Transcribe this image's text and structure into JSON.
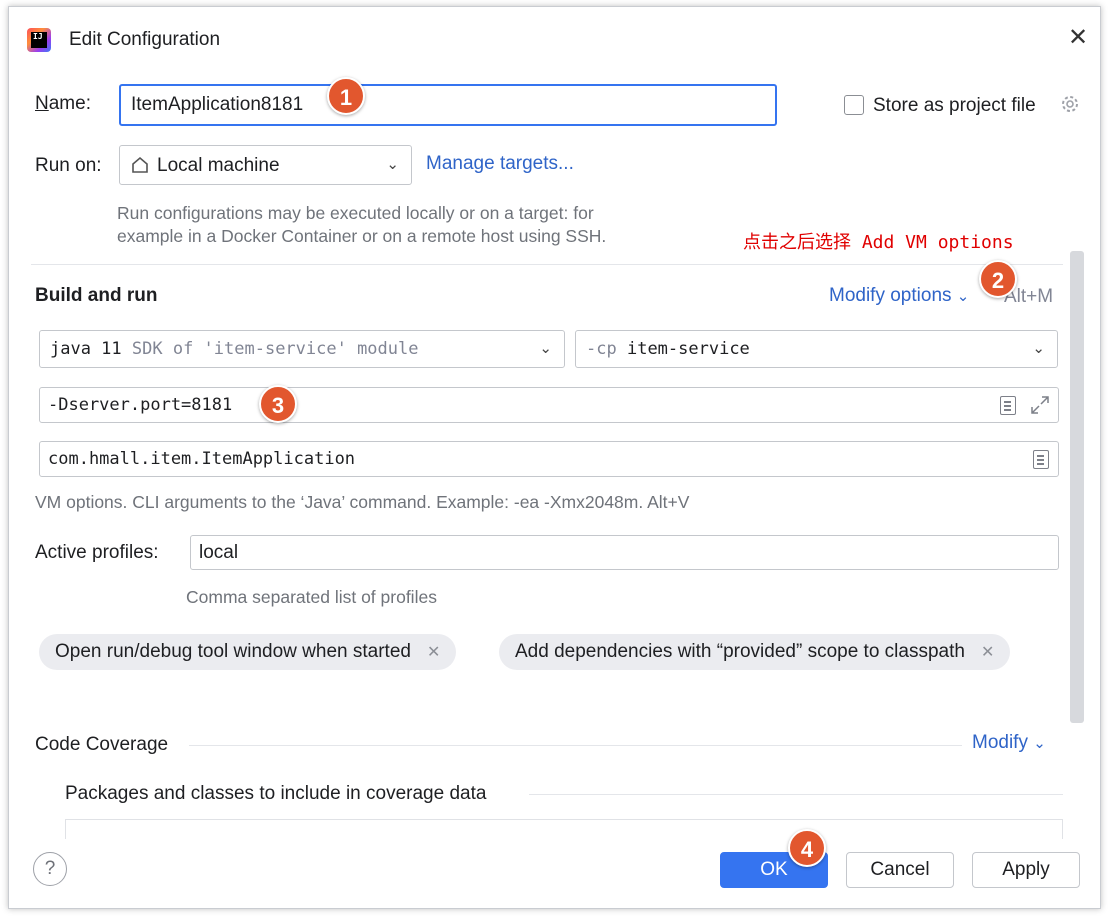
{
  "dialog": {
    "title": "Edit Configuration",
    "logo_text": "IJ"
  },
  "name": {
    "label_prefix": "N",
    "label_rest": "ame:",
    "value": "ItemApplication8181"
  },
  "store_as_project_file": {
    "label": "Store as project file",
    "checked": false
  },
  "run_on": {
    "label": "Run on:",
    "selected": "Local machine",
    "manage_link": "Manage targets...",
    "hint_line1": "Run configurations may be executed locally or on a target: for",
    "hint_line2": "example in a Docker Container or on a remote host using SSH."
  },
  "build_and_run": {
    "title": "Build and run",
    "modify_options": "Modify options",
    "modify_shortcut": "Alt+M",
    "sdk_main": "java 11",
    "sdk_detail": "SDK of 'item-service' module",
    "cp_flag": "-cp",
    "cp_value": "item-service",
    "vm_options": "-Dserver.port=8181",
    "main_class": "com.hmall.item.ItemApplication",
    "vm_hint": "VM options. CLI arguments to the ‘Java’ command. Example: -ea -Xmx2048m. Alt+V"
  },
  "active_profiles": {
    "label": "Active profiles:",
    "value": "local",
    "hint": "Comma separated list of profiles"
  },
  "chips": [
    {
      "label": "Open run/debug tool window when started"
    },
    {
      "label": "Add dependencies with “provided” scope to classpath"
    }
  ],
  "code_coverage": {
    "title": "Code Coverage",
    "modify": "Modify",
    "packages_title": "Packages and classes to include in coverage data"
  },
  "buttons": {
    "ok": "OK",
    "cancel": "Cancel",
    "apply": "Apply",
    "help": "?"
  },
  "annotations": {
    "badge1": "1",
    "badge2": "2",
    "badge3": "3",
    "badge4": "4",
    "note": "点击之后选择 Add VM options"
  },
  "colors": {
    "accent": "#3574f0",
    "link": "#2f64c8",
    "annotation_red": "#e00000",
    "badge": "#e2572e"
  }
}
